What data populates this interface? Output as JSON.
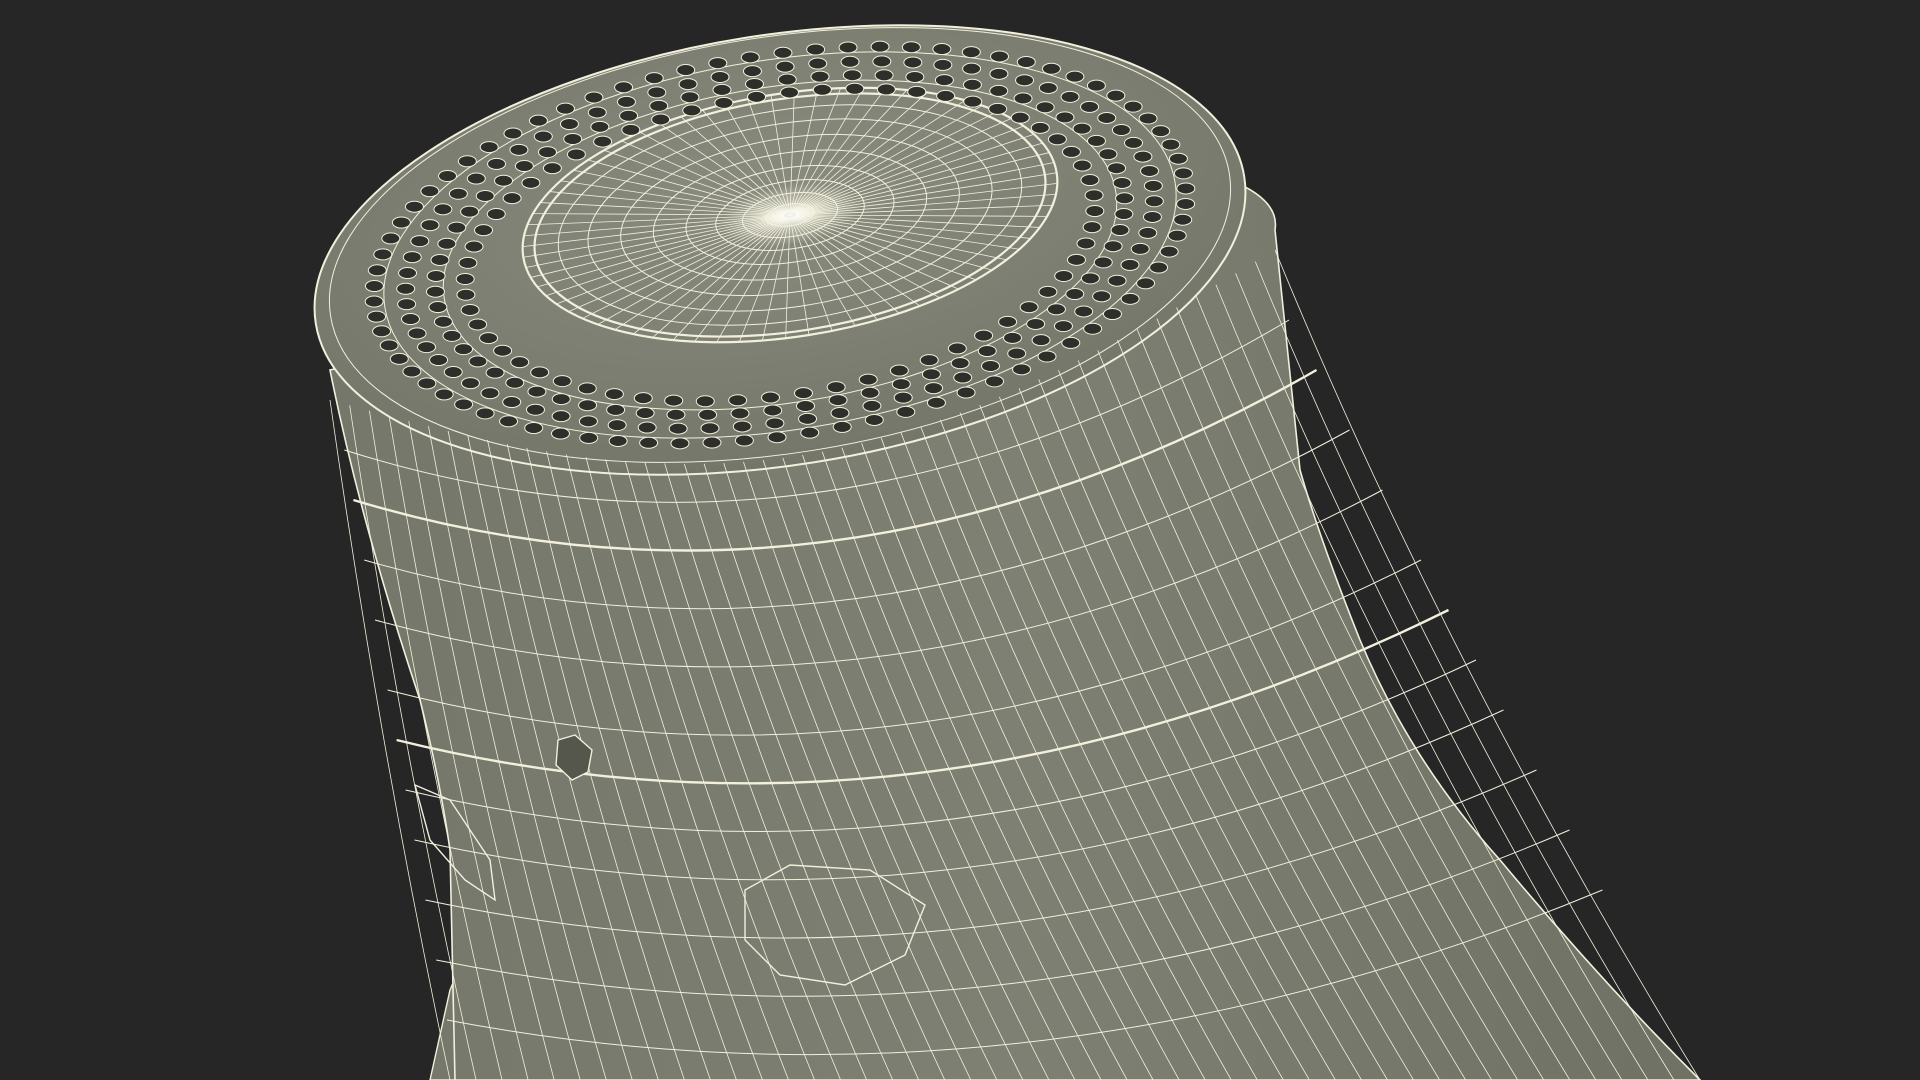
{
  "scene": {
    "subject": "wireframe-3d-model",
    "colors": {
      "background": "#262626",
      "surface": "#7b7d70",
      "surface_dark": "#6d6f63",
      "surface_light": "#85877a",
      "wire": "#f2f0dc",
      "hole": "#2e2f2a"
    }
  }
}
